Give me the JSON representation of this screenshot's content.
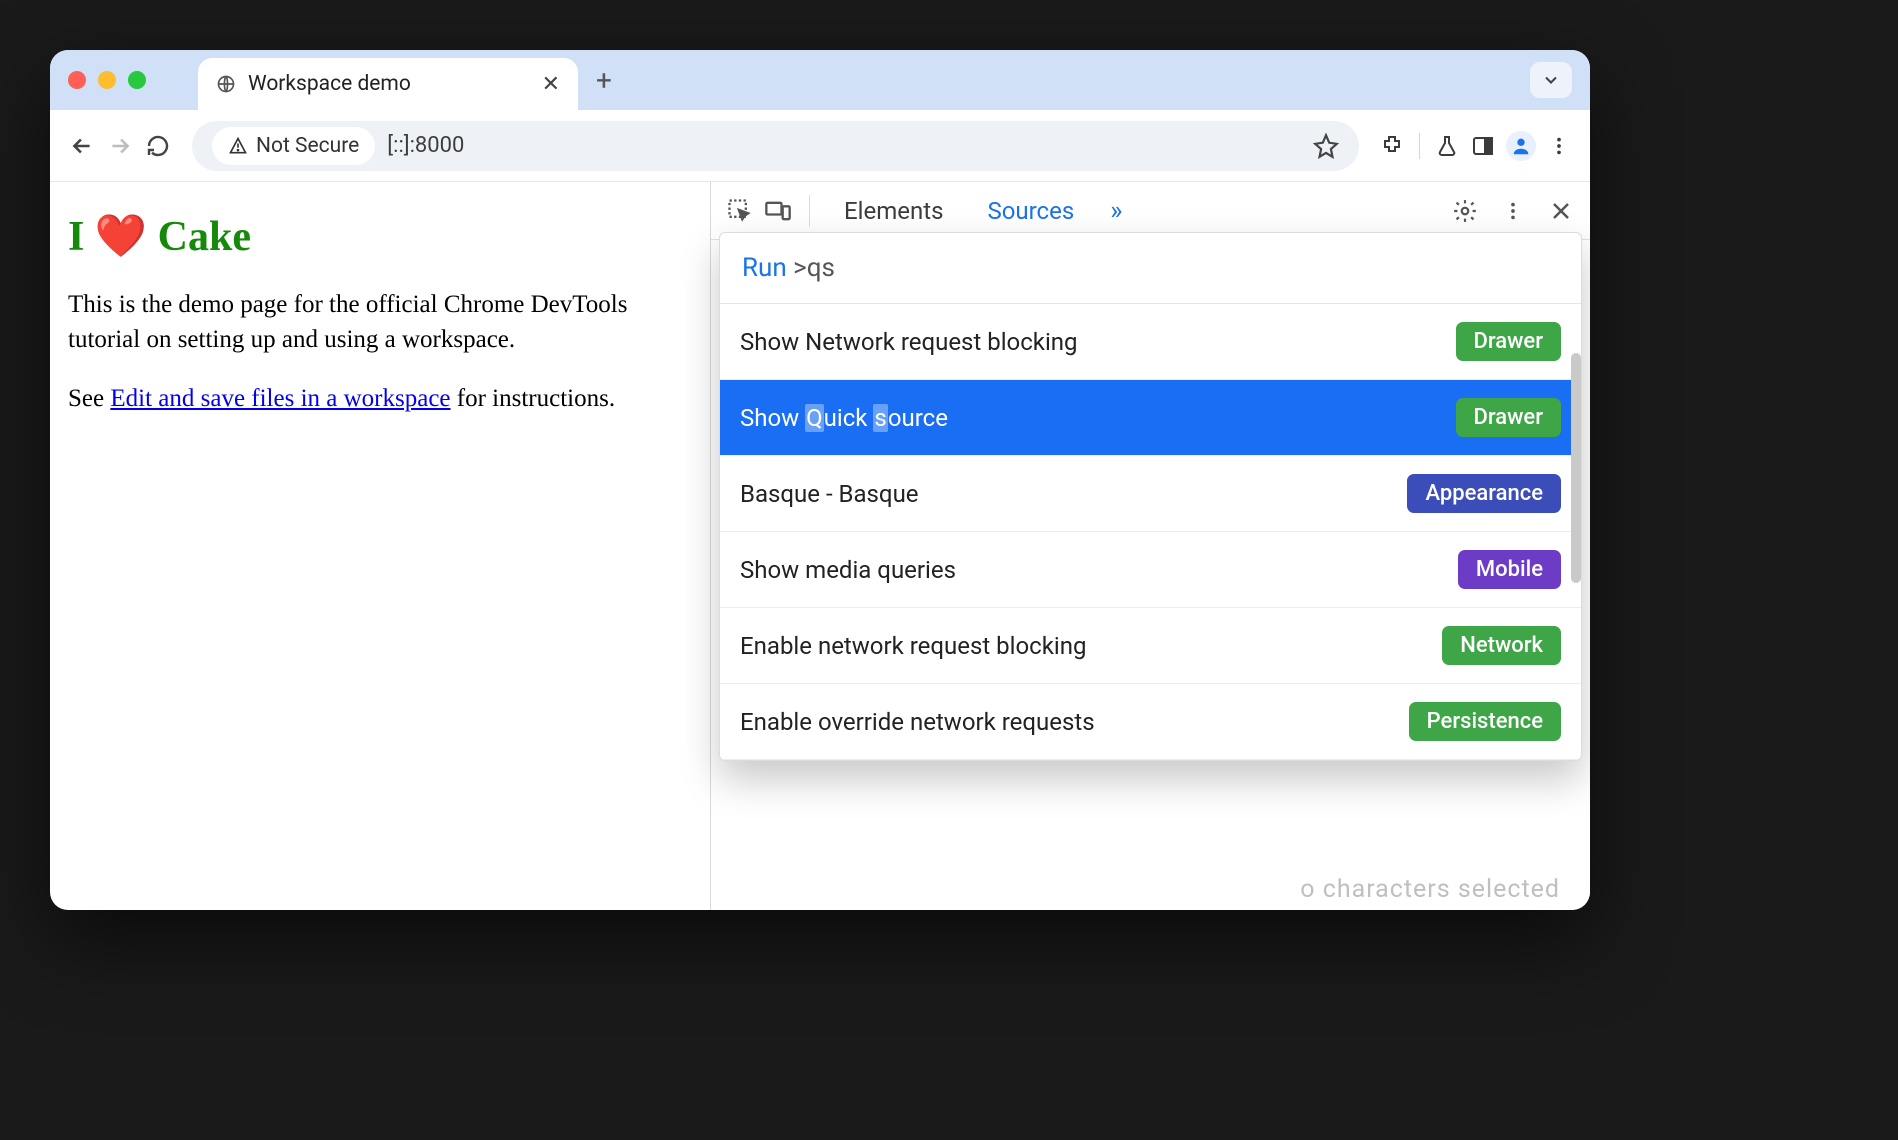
{
  "browser": {
    "tab_title": "Workspace demo",
    "security_label": "Not Secure",
    "url": "[::]:8000"
  },
  "page": {
    "heading": "I ❤️ Cake",
    "para1": "This is the demo page for the official Chrome DevTools tutorial on setting up and using a workspace.",
    "para2_prefix": "See ",
    "para2_link": "Edit and save files in a workspace",
    "para2_suffix": " for instructions."
  },
  "devtools": {
    "tabs": {
      "elements": "Elements",
      "sources": "Sources"
    },
    "cmd_run": "Run",
    "cmd_query": ">qs",
    "items": [
      {
        "label": "Show Network request blocking",
        "badge": "Drawer",
        "color": "b-green",
        "selected": false
      },
      {
        "label": "Show Quick source",
        "badge": "Drawer",
        "color": "b-green",
        "selected": true
      },
      {
        "label": "Basque - Basque",
        "badge": "Appearance",
        "color": "b-blue",
        "selected": false
      },
      {
        "label": "Show media queries",
        "badge": "Mobile",
        "color": "b-purple",
        "selected": false
      },
      {
        "label": "Enable network request blocking",
        "badge": "Network",
        "color": "b-green",
        "selected": false
      },
      {
        "label": "Enable override network requests",
        "badge": "Persistence",
        "color": "b-green",
        "selected": false
      }
    ],
    "bottom_status": "o characters selected"
  }
}
